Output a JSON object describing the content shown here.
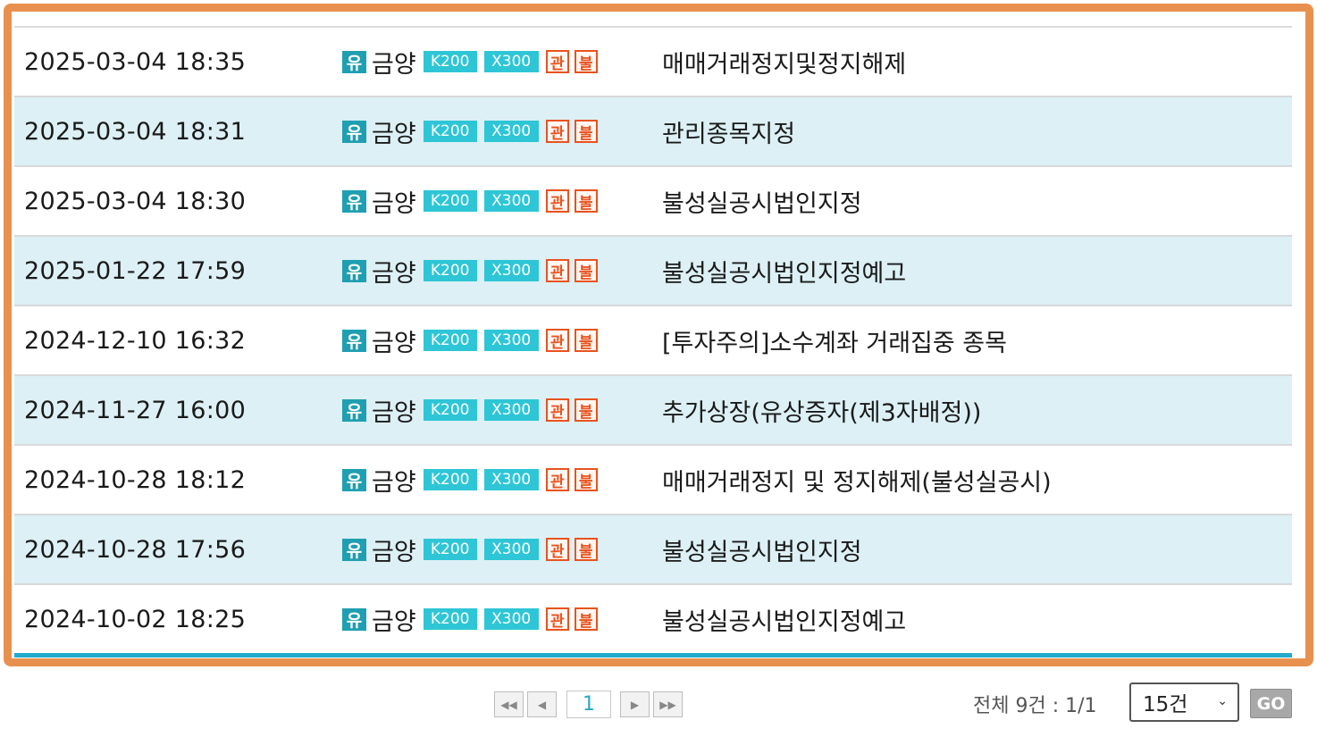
{
  "rows": [
    {
      "date": "2025-03-04 18:35",
      "stock": "금양",
      "title": "매매거래정지및정지해제"
    },
    {
      "date": "2025-03-04 18:31",
      "stock": "금양",
      "title": "관리종목지정"
    },
    {
      "date": "2025-03-04 18:30",
      "stock": "금양",
      "title": "불성실공시법인지정"
    },
    {
      "date": "2025-01-22 17:59",
      "stock": "금양",
      "title": "불성실공시법인지정예고"
    },
    {
      "date": "2024-12-10 16:32",
      "stock": "금양",
      "title": "[투자주의]소수계좌 거래집중 종목"
    },
    {
      "date": "2024-11-27 16:00",
      "stock": "금양",
      "title": "추가상장(유상증자(제3자배정))"
    },
    {
      "date": "2024-10-28 18:12",
      "stock": "금양",
      "title": "매매거래정지 및 정지해제(불성실공시)"
    },
    {
      "date": "2024-10-28 17:56",
      "stock": "금양",
      "title": "불성실공시법인지정"
    },
    {
      "date": "2024-10-02 18:25",
      "stock": "금양",
      "title": "불성실공시법인지정예고"
    }
  ],
  "tags": {
    "market": "유",
    "k200": "K200",
    "x300": "X300",
    "managed": "관",
    "unfaithful": "불"
  },
  "pagination": {
    "first": "◀◀",
    "prev": "◀",
    "current_page": "1",
    "next": "▶",
    "last": "▶▶"
  },
  "summary": "전체 9건 : 1/1",
  "page_size": {
    "selected": "15건",
    "chevron": "⌄"
  },
  "go_label": "GO",
  "colors": {
    "frame": "#e8914f",
    "row_alt": "#dcf0f5",
    "accent": "#22aacb",
    "tag_red": "#e8531f"
  }
}
